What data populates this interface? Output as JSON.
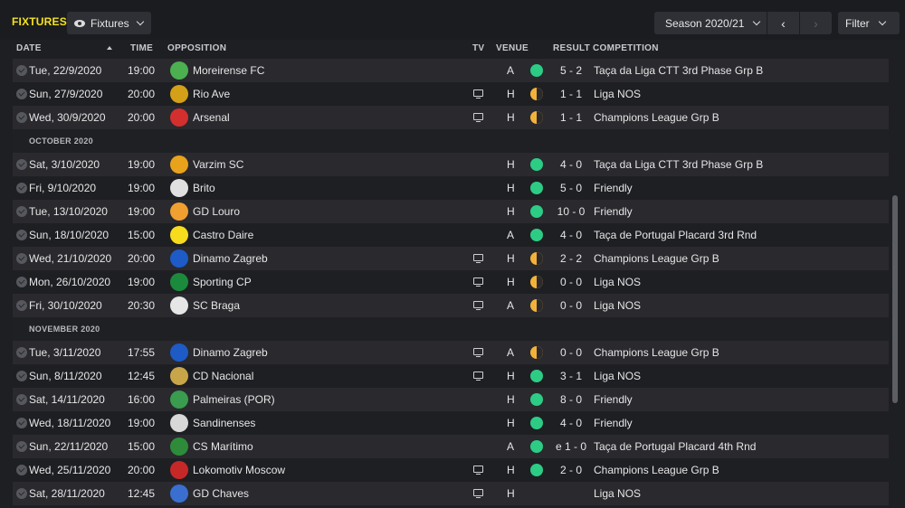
{
  "header": {
    "title": "FIXTURES",
    "view_label": "Fixtures",
    "season_label": "Season 2020/21",
    "prev_symbol": "‹",
    "next_symbol": "›",
    "filter_label": "Filter"
  },
  "columns": {
    "date": "DATE",
    "time": "TIME",
    "opposition": "OPPOSITION",
    "tv": "TV",
    "venue": "VENUE",
    "result": "RESULT",
    "competition": "COMPETITION"
  },
  "colors": {
    "title": "#f5e21d",
    "win": "#2dcc85",
    "draw": "#f2b23a"
  },
  "rows": [
    {
      "kind": "fixture",
      "date": "Tue, 22/9/2020",
      "time": "19:00",
      "opponent": "Moreirense FC",
      "tv": false,
      "venue": "A",
      "outcome": "win",
      "score": "5 - 2",
      "competition": "Taça da Liga CTT 3rd Phase Grp B",
      "badge": "#4caf50"
    },
    {
      "kind": "fixture",
      "date": "Sun, 27/9/2020",
      "time": "20:00",
      "opponent": "Rio Ave",
      "tv": true,
      "venue": "H",
      "outcome": "draw",
      "score": "1 - 1",
      "competition": "Liga NOS",
      "badge": "#d4a017"
    },
    {
      "kind": "fixture",
      "date": "Wed, 30/9/2020",
      "time": "20:00",
      "opponent": "Arsenal",
      "tv": true,
      "venue": "H",
      "outcome": "draw",
      "score": "1 - 1",
      "competition": "Champions League Grp B",
      "badge": "#d32f2f"
    },
    {
      "kind": "month",
      "label": "OCTOBER 2020"
    },
    {
      "kind": "fixture",
      "date": "Sat, 3/10/2020",
      "time": "19:00",
      "opponent": "Varzim SC",
      "tv": false,
      "venue": "H",
      "outcome": "win",
      "score": "4 - 0",
      "competition": "Taça da Liga CTT 3rd Phase Grp B",
      "badge": "#e9a21b"
    },
    {
      "kind": "fixture",
      "date": "Fri, 9/10/2020",
      "time": "19:00",
      "opponent": "Brito",
      "tv": false,
      "venue": "H",
      "outcome": "win",
      "score": "5 - 0",
      "competition": "Friendly",
      "badge": "#e0e0e0"
    },
    {
      "kind": "fixture",
      "date": "Tue, 13/10/2020",
      "time": "19:00",
      "opponent": "GD Louro",
      "tv": false,
      "venue": "H",
      "outcome": "win",
      "score": "10 - 0",
      "competition": "Friendly",
      "badge": "#f0a030"
    },
    {
      "kind": "fixture",
      "date": "Sun, 18/10/2020",
      "time": "15:00",
      "opponent": "Castro Daire",
      "tv": false,
      "venue": "A",
      "outcome": "win",
      "score": "4 - 0",
      "competition": "Taça de Portugal Placard 3rd Rnd",
      "badge": "#f7dc1e"
    },
    {
      "kind": "fixture",
      "date": "Wed, 21/10/2020",
      "time": "20:00",
      "opponent": "Dinamo Zagreb",
      "tv": true,
      "venue": "H",
      "outcome": "draw",
      "score": "2 - 2",
      "competition": "Champions League Grp B",
      "badge": "#1e5bc6"
    },
    {
      "kind": "fixture",
      "date": "Mon, 26/10/2020",
      "time": "19:00",
      "opponent": "Sporting CP",
      "tv": true,
      "venue": "H",
      "outcome": "draw",
      "score": "0 - 0",
      "competition": "Liga NOS",
      "badge": "#1c8a3c"
    },
    {
      "kind": "fixture",
      "date": "Fri, 30/10/2020",
      "time": "20:30",
      "opponent": "SC Braga",
      "tv": true,
      "venue": "A",
      "outcome": "draw",
      "score": "0 - 0",
      "competition": "Liga NOS",
      "badge": "#e6e6e6"
    },
    {
      "kind": "month",
      "label": "NOVEMBER 2020"
    },
    {
      "kind": "fixture",
      "date": "Tue, 3/11/2020",
      "time": "17:55",
      "opponent": "Dinamo Zagreb",
      "tv": true,
      "venue": "A",
      "outcome": "draw",
      "score": "0 - 0",
      "competition": "Champions League Grp B",
      "badge": "#1e5bc6"
    },
    {
      "kind": "fixture",
      "date": "Sun, 8/11/2020",
      "time": "12:45",
      "opponent": "CD Nacional",
      "tv": true,
      "venue": "H",
      "outcome": "win",
      "score": "3 - 1",
      "competition": "Liga NOS",
      "badge": "#c9a54a"
    },
    {
      "kind": "fixture",
      "date": "Sat, 14/11/2020",
      "time": "16:00",
      "opponent": "Palmeiras (POR)",
      "tv": false,
      "venue": "H",
      "outcome": "win",
      "score": "8 - 0",
      "competition": "Friendly",
      "badge": "#3a9c4e"
    },
    {
      "kind": "fixture",
      "date": "Wed, 18/11/2020",
      "time": "19:00",
      "opponent": "Sandinenses",
      "tv": false,
      "venue": "H",
      "outcome": "win",
      "score": "4 - 0",
      "competition": "Friendly",
      "badge": "#d8d8d8"
    },
    {
      "kind": "fixture",
      "date": "Sun, 22/11/2020",
      "time": "15:00",
      "opponent": "CS Marítimo",
      "tv": false,
      "venue": "A",
      "outcome": "win",
      "score": "e 1 - 0",
      "competition": "Taça de Portugal Placard 4th Rnd",
      "badge": "#2e8b3a"
    },
    {
      "kind": "fixture",
      "date": "Wed, 25/11/2020",
      "time": "20:00",
      "opponent": "Lokomotiv Moscow",
      "tv": true,
      "venue": "H",
      "outcome": "win",
      "score": "2 - 0",
      "competition": "Champions League Grp B",
      "badge": "#c62828"
    },
    {
      "kind": "fixture",
      "date": "Sat, 28/11/2020",
      "time": "12:45",
      "opponent": "GD Chaves",
      "tv": true,
      "venue": "H",
      "outcome": "none",
      "score": "",
      "competition": "Liga NOS",
      "badge": "#3a6fd0"
    }
  ]
}
